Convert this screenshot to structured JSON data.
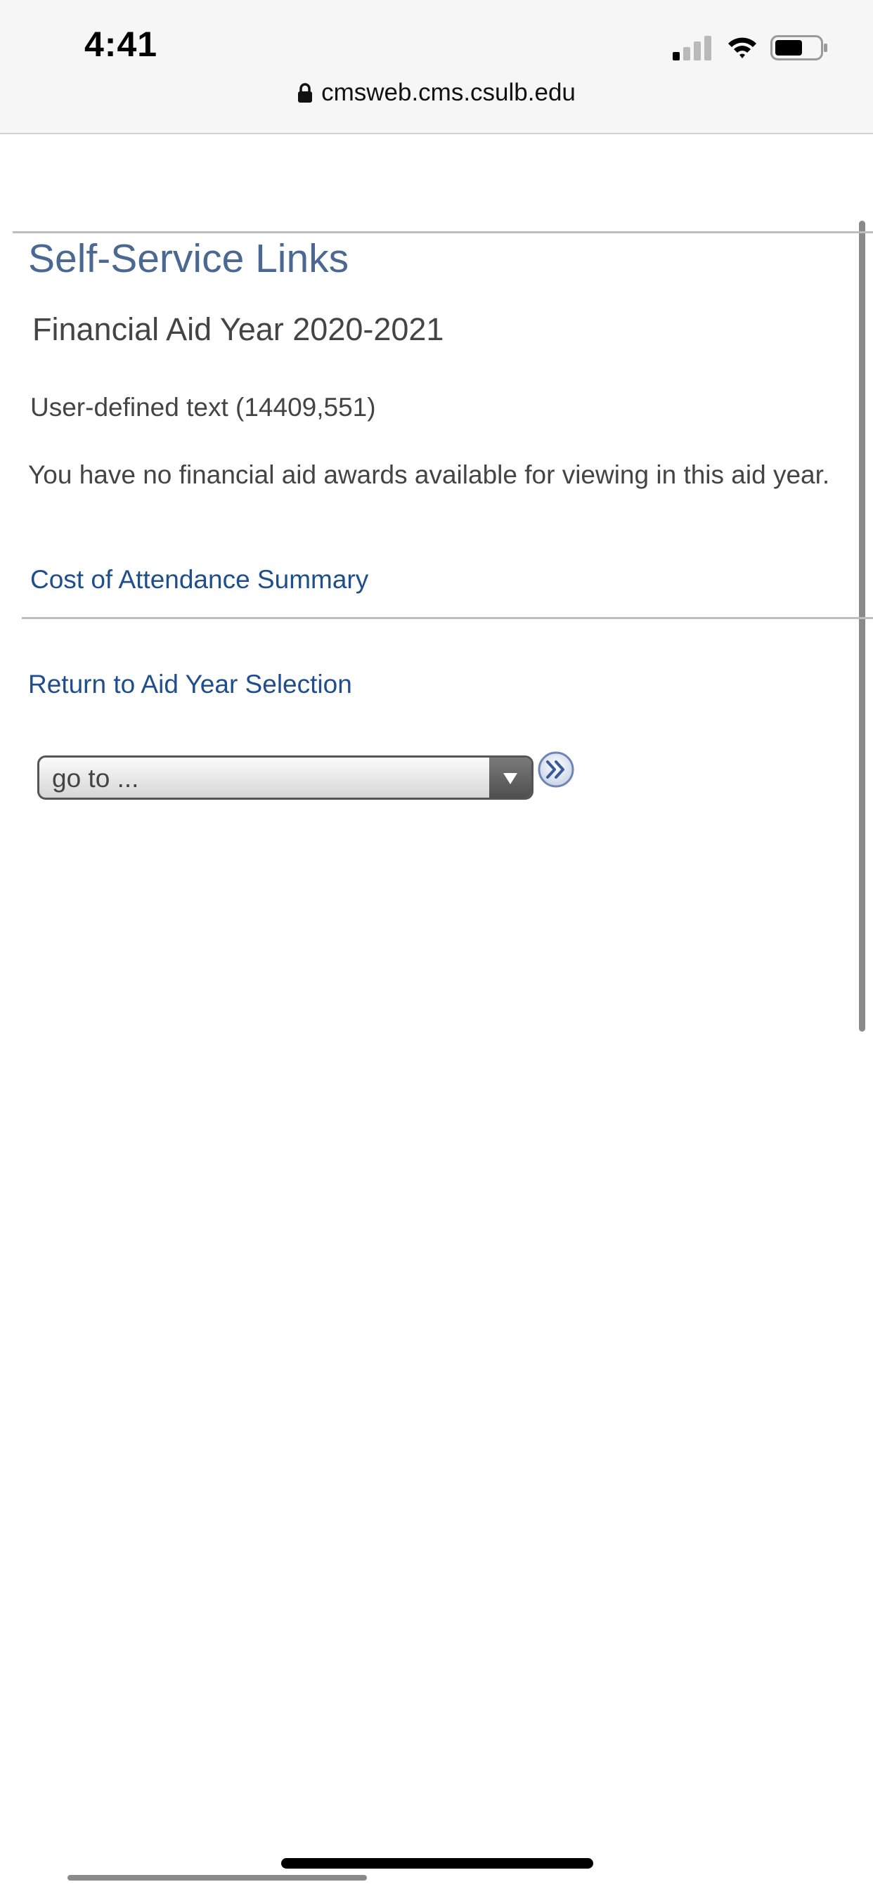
{
  "status_bar": {
    "time": "4:41",
    "icons": [
      "cellular-signal-icon",
      "wifi-icon",
      "battery-icon"
    ]
  },
  "browser": {
    "url": "cmsweb.cms.csulb.edu",
    "url_icon": "lock-icon"
  },
  "page": {
    "title": "Self-Service Links",
    "aid_year": "Financial Aid Year 2020-2021",
    "user_defined_text": "User-defined text (14409,551)",
    "no_awards_message": "You have no financial aid awards available for viewing in this aid year.",
    "cost_link": "Cost of Attendance Summary",
    "return_link": "Return to Aid Year Selection",
    "goto_select": {
      "selected": "go to ...",
      "arrow_icon": "chevron-down-icon"
    },
    "go_button_icon": "double-chevron-right-icon"
  },
  "colors": {
    "title": "#4a6891",
    "link": "#1f4e8c",
    "body_text": "#444444",
    "chrome_bg": "#f6f6f6"
  }
}
